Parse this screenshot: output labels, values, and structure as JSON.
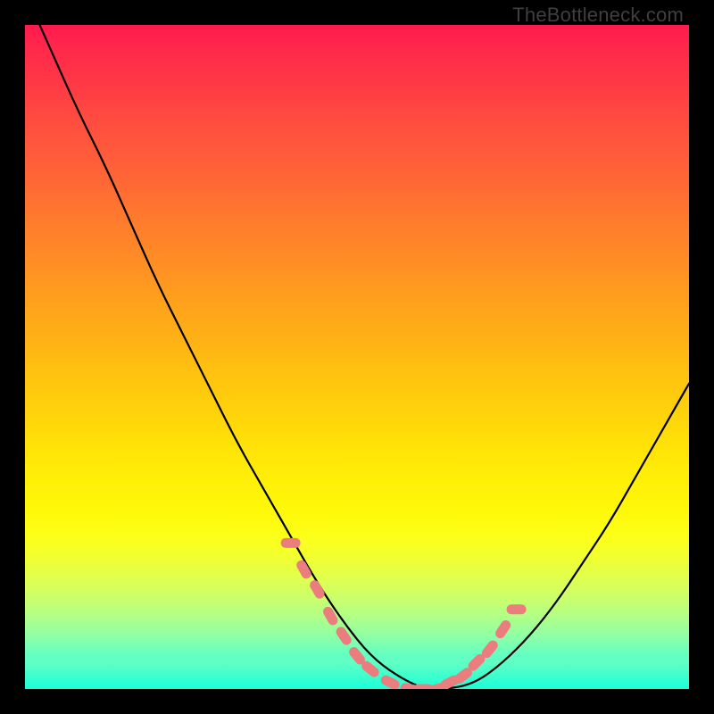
{
  "watermark": "TheBottleneck.com",
  "colors": {
    "frame": "#000000",
    "curve": "#000000",
    "marker": "#ec7d7f",
    "gradient_top": "#ff1a4d",
    "gradient_bottom": "#1affd9"
  },
  "chart_data": {
    "type": "line",
    "title": "",
    "xlabel": "",
    "ylabel": "",
    "xlim": [
      0,
      100
    ],
    "ylim": [
      0,
      100
    ],
    "grid": false,
    "legend": false,
    "annotations": [
      "TheBottleneck.com"
    ],
    "series": [
      {
        "name": "bottleneck-curve",
        "x": [
          0,
          4,
          8,
          12,
          16,
          20,
          24,
          28,
          32,
          36,
          40,
          44,
          48,
          52,
          56,
          60,
          64,
          68,
          72,
          76,
          80,
          84,
          88,
          92,
          96,
          100
        ],
        "y": [
          105,
          96,
          87,
          79,
          70,
          61,
          53,
          45,
          37,
          30,
          23,
          16,
          10,
          5,
          2,
          0,
          0,
          1,
          4,
          8,
          13,
          19,
          25,
          32,
          39,
          46
        ]
      }
    ],
    "markers": {
      "name": "highlight-dots",
      "x": [
        40,
        42,
        44,
        46,
        48,
        50,
        52,
        55,
        58,
        60,
        62,
        64,
        66,
        68,
        70,
        72,
        74
      ],
      "y": [
        22,
        18,
        15,
        11,
        8,
        5,
        3,
        1,
        0,
        0,
        0,
        1,
        2,
        4,
        6,
        9,
        12
      ]
    }
  }
}
